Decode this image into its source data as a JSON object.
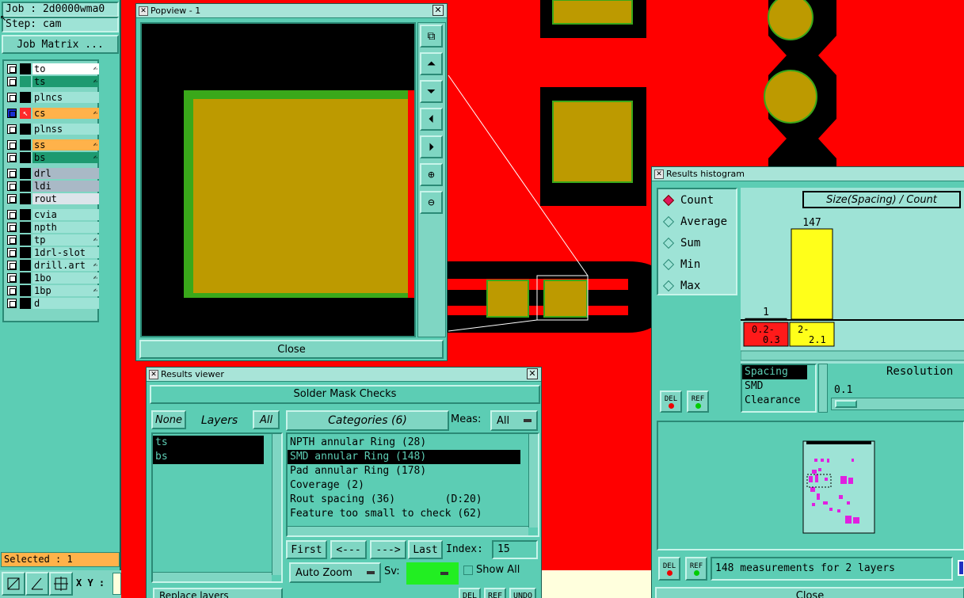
{
  "job_panel": {
    "job_label": "Job : 2d0000wma0",
    "step_label": "Step: cam",
    "job_matrix_button": "Job Matrix ...",
    "selected_label": "Selected : 1",
    "xy_label": "X Y :"
  },
  "layers": [
    {
      "name": "to",
      "color": "#ffffff",
      "swatch": "#000000",
      "hand": true
    },
    {
      "name": "ts",
      "color": "#1d9a70",
      "swatch": "#1d9a70",
      "hand": true
    },
    {
      "name": "plncs",
      "color": "#9ee3d6",
      "swatch": "#000000",
      "hand": false
    },
    {
      "name": "cs",
      "color": "#ffb24a",
      "swatch": "#ff2a2a",
      "hand": true,
      "active": true
    },
    {
      "name": "plnss",
      "color": "#9ee3d6",
      "swatch": "#000000",
      "hand": false
    },
    {
      "name": "ss",
      "color": "#ffb24a",
      "swatch": "#000000",
      "hand": true
    },
    {
      "name": "bs",
      "color": "#1d9a70",
      "swatch": "#000000",
      "hand": true
    },
    {
      "name": "drl",
      "color": "#a9b9c6",
      "swatch": "#000000",
      "hand": false
    },
    {
      "name": "ldi",
      "color": "#a9b9c6",
      "swatch": "#000000",
      "hand": false
    },
    {
      "name": "rout",
      "color": "#dce4ea",
      "swatch": "#000000",
      "hand": false
    },
    {
      "name": "cvia",
      "color": "#9ee3d6",
      "swatch": "#000000",
      "hand": false
    },
    {
      "name": "npth",
      "color": "#9ee3d6",
      "swatch": "#000000",
      "hand": false
    },
    {
      "name": "tp",
      "color": "#9ee3d6",
      "swatch": "#000000",
      "hand": true
    },
    {
      "name": "1drl-slot",
      "color": "#9ee3d6",
      "swatch": "#000000",
      "hand": false
    },
    {
      "name": "drill.art",
      "color": "#9ee3d6",
      "swatch": "#000000",
      "hand": true
    },
    {
      "name": "1bo",
      "color": "#9ee3d6",
      "swatch": "#000000",
      "hand": true
    },
    {
      "name": "1bp",
      "color": "#9ee3d6",
      "swatch": "#000000",
      "hand": true
    },
    {
      "name": "d",
      "color": "#9ee3d6",
      "swatch": "#000000",
      "hand": false
    }
  ],
  "popview": {
    "title": "Popview - 1",
    "close_label": "Close",
    "pad_fill": "#bd9a00",
    "pad_border": "#3aa81a"
  },
  "results_viewer": {
    "title": "Results viewer",
    "header": "Solder Mask Checks",
    "none_button": "None",
    "layers_label": "Layers",
    "all_button": "All",
    "layer_items": [
      "ts",
      "bs"
    ],
    "categories_label": "Categories (6)",
    "meas_label": "Meas:",
    "meas_value": "All",
    "categories": [
      {
        "text": "NPTH annular Ring (28)",
        "selected": false
      },
      {
        "text": "SMD annular Ring (148)",
        "selected": true
      },
      {
        "text": "Pad annular Ring (178)",
        "selected": false
      },
      {
        "text": "Coverage (2)",
        "selected": false
      },
      {
        "text": "Rout spacing (36)        (D:20)",
        "selected": false
      },
      {
        "text": "Feature too small to check (62)",
        "selected": false
      }
    ],
    "first_button": "First",
    "prev_button": "<---",
    "next_button": "--->",
    "last_button": "Last",
    "index_label": "Index:",
    "index_value": "15",
    "auto_zoom_label": "Auto Zoom",
    "sv_label": "Sv:",
    "sv_color": "#22ee22",
    "show_all_label": "Show All",
    "replace_layers_label": "Replace layers",
    "del_label": "DEL",
    "ref_label": "REF",
    "undo_label": "UNDO"
  },
  "histogram": {
    "title": "Results histogram",
    "modes": [
      {
        "label": "Count",
        "on": true
      },
      {
        "label": "Average",
        "on": false
      },
      {
        "label": "Sum",
        "on": false
      },
      {
        "label": "Min",
        "on": false
      },
      {
        "label": "Max",
        "on": false
      }
    ],
    "del_label": "DEL",
    "ref_label": "REF",
    "chart_title": "Size(Spacing) / Count",
    "attributes": [
      "Spacing",
      "SMD",
      "Clearance"
    ],
    "resolution_label": "Resolution",
    "resolution_value": "0.1",
    "status_text": "148 measurements for 2 layers",
    "close_label": "Close"
  },
  "chart_data": {
    "type": "bar",
    "title": "Size(Spacing) / Count",
    "categories": [
      "0.2-\n0.3",
      "2-\n2.1"
    ],
    "values": [
      1,
      147
    ],
    "colors": [
      "#ff1a1a",
      "#ffff1a"
    ],
    "value_labels": [
      "1",
      "147"
    ],
    "ylim": [
      0,
      147
    ]
  }
}
